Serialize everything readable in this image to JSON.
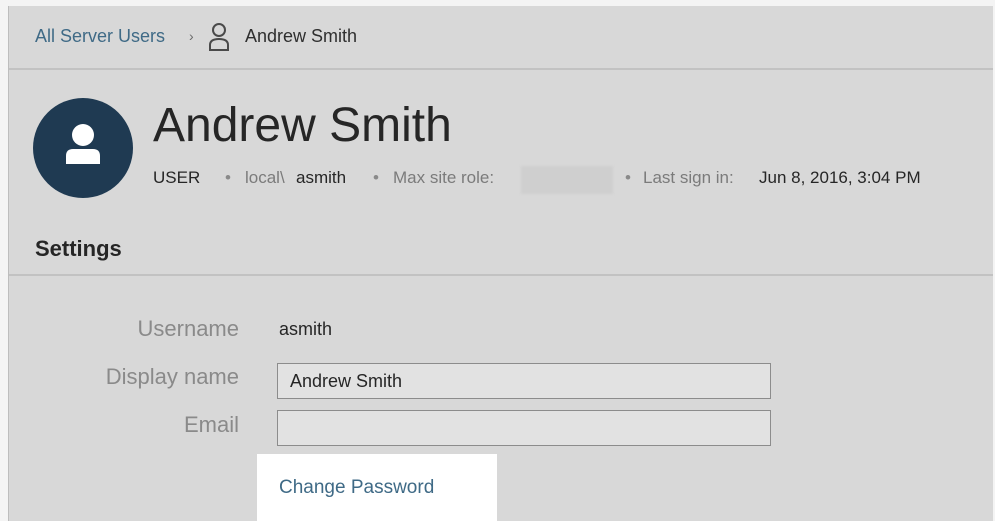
{
  "breadcrumb": {
    "parent_link": "All Server Users",
    "separator": "›",
    "current": "Andrew Smith",
    "user_icon": "user-outline-icon"
  },
  "header": {
    "avatar_icon": "user-silhouette-icon",
    "name": "Andrew Smith",
    "meta": {
      "role": "USER",
      "domain_prefix": "local\\",
      "username": "asmith",
      "max_role_label": "Max site role:",
      "last_signin_label": "Last sign in:",
      "last_signin_value": "Jun 8, 2016, 3:04 PM",
      "separator": "•"
    }
  },
  "settings": {
    "title": "Settings",
    "username_label": "Username",
    "username_value": "asmith",
    "display_name_label": "Display name",
    "display_name_value": "Andrew Smith",
    "email_label": "Email",
    "email_value": "",
    "change_password": "Change Password"
  },
  "colors": {
    "page_bg": "#d8d8d8",
    "link": "#3f6a86",
    "avatar": "#1f3a52",
    "highlight": "#ffffff"
  }
}
